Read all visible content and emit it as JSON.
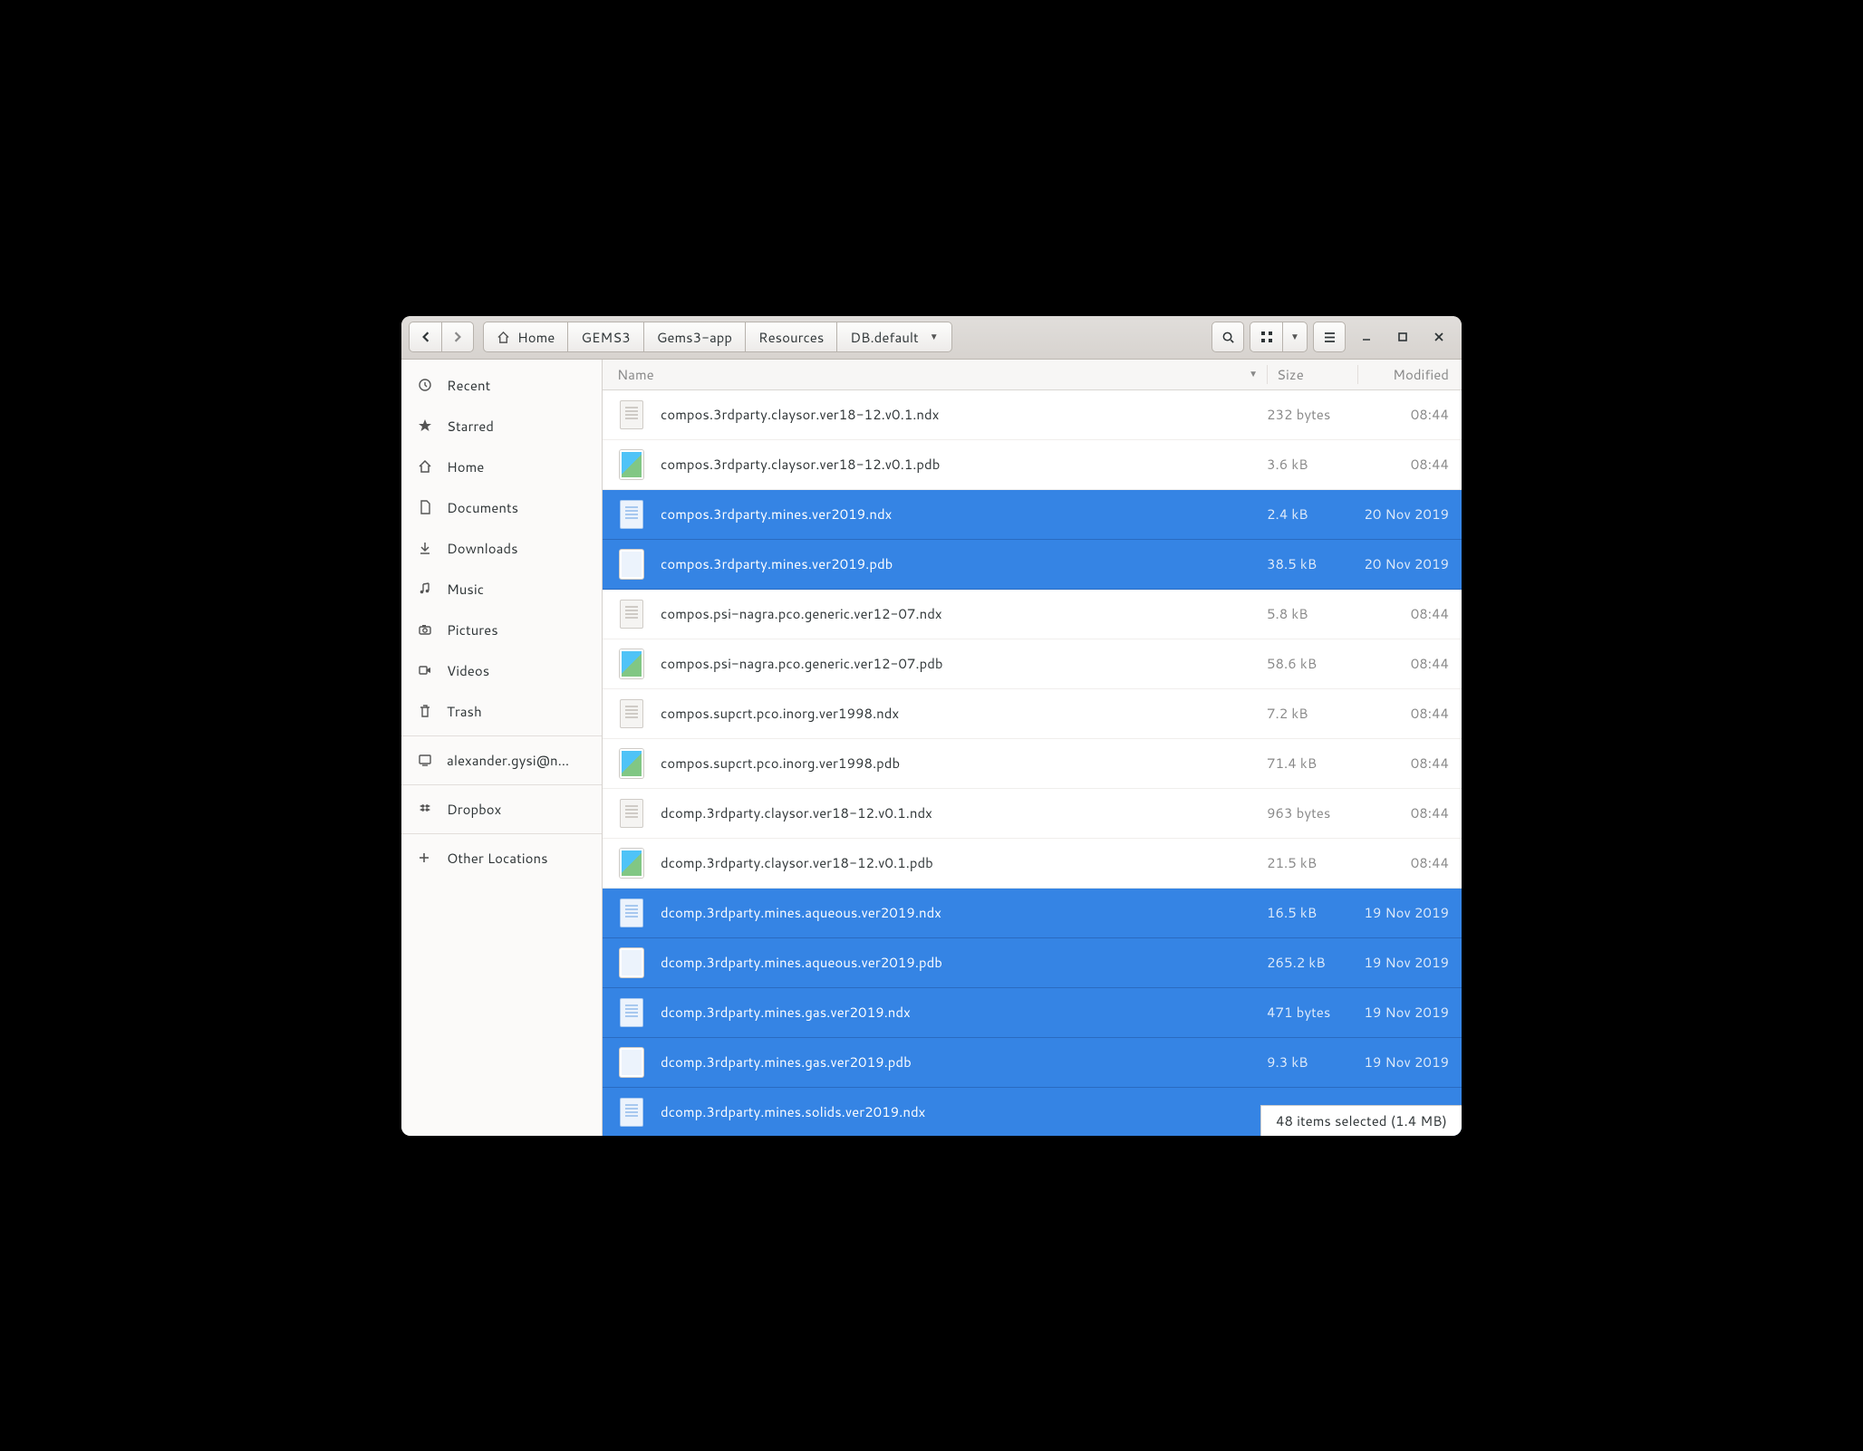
{
  "breadcrumbs": [
    "Home",
    "GEMS3",
    "Gems3-app",
    "Resources",
    "DB.default"
  ],
  "sidebar": {
    "items": [
      {
        "icon": "clock",
        "label": "Recent"
      },
      {
        "icon": "star",
        "label": "Starred"
      },
      {
        "icon": "home",
        "label": "Home"
      },
      {
        "icon": "doc",
        "label": "Documents"
      },
      {
        "icon": "download",
        "label": "Downloads"
      },
      {
        "icon": "music",
        "label": "Music"
      },
      {
        "icon": "camera",
        "label": "Pictures"
      },
      {
        "icon": "video",
        "label": "Videos"
      },
      {
        "icon": "trash",
        "label": "Trash"
      }
    ],
    "account": "alexander.gysi@n…",
    "dropbox": "Dropbox",
    "other": "Other Locations"
  },
  "columns": {
    "name": "Name",
    "size": "Size",
    "modified": "Modified"
  },
  "files": [
    {
      "name": "compos.3rdparty.claysor.ver18-12.v0.1.ndx",
      "size": "232 bytes",
      "mod": "08:44",
      "type": "ndx",
      "selected": false
    },
    {
      "name": "compos.3rdparty.claysor.ver18-12.v0.1.pdb",
      "size": "3.6 kB",
      "mod": "08:44",
      "type": "pdb",
      "selected": false
    },
    {
      "name": "compos.3rdparty.mines.ver2019.ndx",
      "size": "2.4 kB",
      "mod": "20 Nov 2019",
      "type": "ndx",
      "selected": true
    },
    {
      "name": "compos.3rdparty.mines.ver2019.pdb",
      "size": "38.5 kB",
      "mod": "20 Nov 2019",
      "type": "pdb",
      "selected": true
    },
    {
      "name": "compos.psi-nagra.pco.generic.ver12-07.ndx",
      "size": "5.8 kB",
      "mod": "08:44",
      "type": "ndx",
      "selected": false
    },
    {
      "name": "compos.psi-nagra.pco.generic.ver12-07.pdb",
      "size": "58.6 kB",
      "mod": "08:44",
      "type": "pdb",
      "selected": false
    },
    {
      "name": "compos.supcrt.pco.inorg.ver1998.ndx",
      "size": "7.2 kB",
      "mod": "08:44",
      "type": "ndx",
      "selected": false
    },
    {
      "name": "compos.supcrt.pco.inorg.ver1998.pdb",
      "size": "71.4 kB",
      "mod": "08:44",
      "type": "pdb",
      "selected": false
    },
    {
      "name": "dcomp.3rdparty.claysor.ver18-12.v0.1.ndx",
      "size": "963 bytes",
      "mod": "08:44",
      "type": "ndx",
      "selected": false
    },
    {
      "name": "dcomp.3rdparty.claysor.ver18-12.v0.1.pdb",
      "size": "21.5 kB",
      "mod": "08:44",
      "type": "pdb",
      "selected": false
    },
    {
      "name": "dcomp.3rdparty.mines.aqueous.ver2019.ndx",
      "size": "16.5 kB",
      "mod": "19 Nov 2019",
      "type": "ndx",
      "selected": true
    },
    {
      "name": "dcomp.3rdparty.mines.aqueous.ver2019.pdb",
      "size": "265.2 kB",
      "mod": "19 Nov 2019",
      "type": "pdb",
      "selected": true
    },
    {
      "name": "dcomp.3rdparty.mines.gas.ver2019.ndx",
      "size": "471 bytes",
      "mod": "19 Nov 2019",
      "type": "ndx",
      "selected": true
    },
    {
      "name": "dcomp.3rdparty.mines.gas.ver2019.pdb",
      "size": "9.3 kB",
      "mod": "19 Nov 2019",
      "type": "pdb",
      "selected": true
    },
    {
      "name": "dcomp.3rdparty.mines.solids.ver2019.ndx",
      "size": "",
      "mod": "",
      "type": "ndx",
      "selected": true
    }
  ],
  "status": "48 items selected  (1.4 MB)"
}
